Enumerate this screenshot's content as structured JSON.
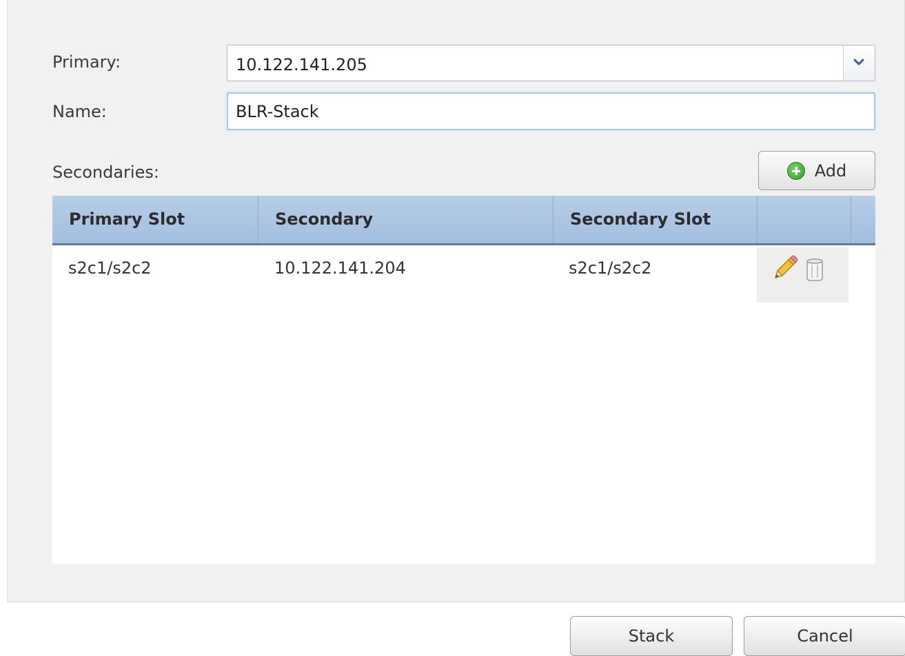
{
  "form": {
    "primary_label": "Primary:",
    "primary_value": "10.122.141.205",
    "name_label": "Name:",
    "name_value": "BLR-Stack",
    "secondaries_label": "Secondaries:",
    "add_label": "Add"
  },
  "table": {
    "columns": [
      "Primary Slot",
      "Secondary",
      "Secondary Slot",
      ""
    ],
    "rows": [
      {
        "primary_slot": "s2c1/s2c2",
        "secondary": "10.122.141.204",
        "secondary_slot": "s2c1/s2c2",
        "actions": [
          "pencil-icon",
          "trash-icon"
        ]
      }
    ]
  },
  "footer": {
    "stack_label": "Stack",
    "cancel_label": "Cancel"
  },
  "colors": {
    "header_bg": "#a3bee0",
    "panel_bg": "#f1f1f1",
    "add_icon": "#2f9a2a"
  }
}
